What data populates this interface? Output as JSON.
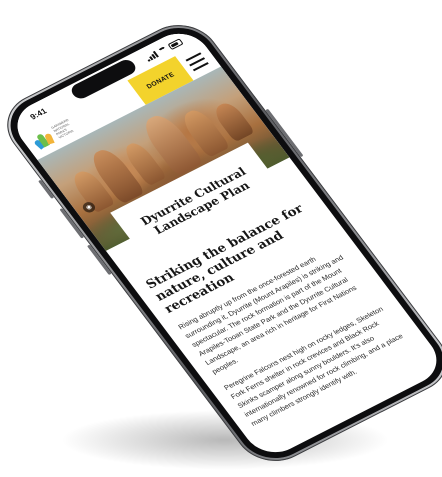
{
  "status_bar": {
    "time": "9:41"
  },
  "header": {
    "logo_lines": [
      "GARIWERD",
      "NATIONAL",
      "PARKS",
      "VICTORIA"
    ],
    "donate_label": "DONATE"
  },
  "page": {
    "title": "Dyurrite Cultural Landscape Plan",
    "section_heading": "Striking the balance for nature, culture and recreation",
    "paragraphs": [
      "Rising abruptly up from the once-forested earth surrounding it, Dyurrite (Mount Arapiles) is striking and spectacular. The rock formation is part of the Mount Arapiles-Tooan State Park and the Dyurrite Cultural Landscape, an area rich in heritage for First Nations peoples.",
      "Peregrine Falcons nest high on rocky ledges, Skeleton Fork Ferns shelter in rock crevices and Black Rock Skinks scamper along sunny boulders. It's also internationally renowned for rock climbing, and a place many climbers strongly identify with."
    ]
  },
  "colors": {
    "donate_yellow": "#f3d32c",
    "logo_blue": "#2e9bd6",
    "logo_green": "#6cbf4b",
    "logo_orange": "#f2b43a"
  },
  "icons": [
    "signal-icon",
    "wifi-icon",
    "battery-icon",
    "hamburger-menu-icon",
    "image-info-icon"
  ]
}
